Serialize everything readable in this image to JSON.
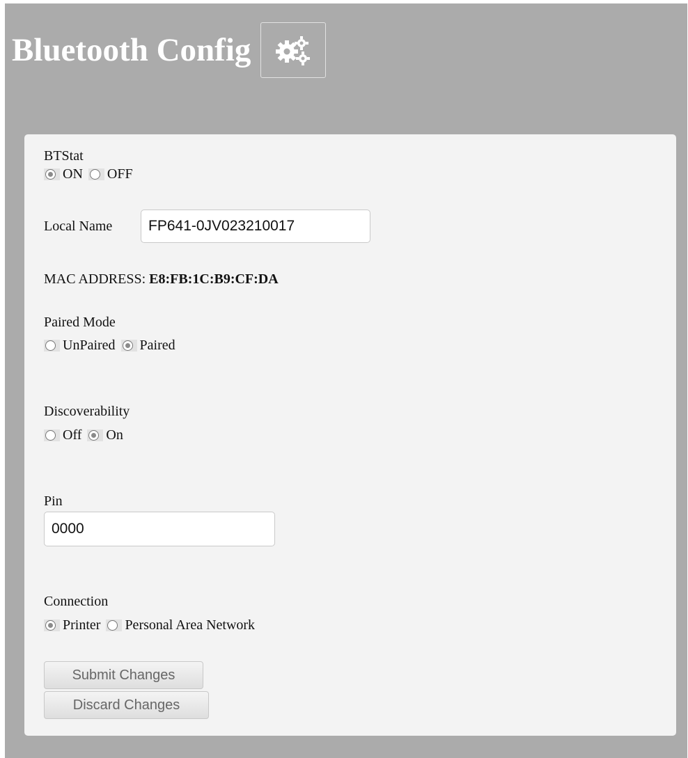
{
  "header": {
    "title": "Bluetooth Config",
    "icon": "gears-icon"
  },
  "btstat": {
    "label": "BTStat",
    "options": [
      {
        "label": "ON",
        "checked": true
      },
      {
        "label": "OFF",
        "checked": false
      }
    ]
  },
  "local_name": {
    "label": "Local Name",
    "value": "FP641-0JV023210017"
  },
  "mac": {
    "label": "MAC ADDRESS:",
    "value": "E8:FB:1C:B9:CF:DA"
  },
  "paired_mode": {
    "label": "Paired Mode",
    "options": [
      {
        "label": "UnPaired",
        "checked": false
      },
      {
        "label": "Paired",
        "checked": true
      }
    ]
  },
  "discoverability": {
    "label": "Discoverability",
    "options": [
      {
        "label": "Off",
        "checked": false
      },
      {
        "label": "On",
        "checked": true
      }
    ]
  },
  "pin": {
    "label": "Pin",
    "value": "0000"
  },
  "connection": {
    "label": "Connection",
    "options": [
      {
        "label": "Printer",
        "checked": true
      },
      {
        "label": "Personal Area Network",
        "checked": false
      }
    ]
  },
  "buttons": {
    "submit": "Submit Changes",
    "discard": "Discard Changes"
  },
  "colors": {
    "background": "#ababab",
    "panel": "#f3f3f3",
    "title": "#ffffff"
  }
}
